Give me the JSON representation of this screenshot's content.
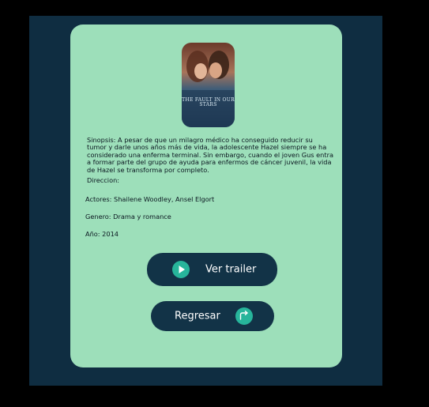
{
  "movie": {
    "poster_title": "THE FAULT IN OUR STARS",
    "synopsis": "Sinopsis: A pesar de que un milagro médico ha conseguido reducir su tumor y darle unos años más de vida, la adolescente Hazel siempre se ha considerado una enferma terminal. Sin embargo, cuando el joven Gus entra a formar parte del grupo de ayuda para enfermos de cáncer juvenil, la vida de Hazel se transforma por completo.",
    "direction": "Direccion:",
    "actors": "Actores: Shailene Woodley, Ansel Elgort",
    "genre": "Genero: Drama y romance",
    "year": "Año: 2014"
  },
  "buttons": {
    "trailer_label": "Ver trailer",
    "back_label": "Regresar"
  },
  "icons": {
    "play": "play-icon",
    "back": "return-arrow-icon"
  },
  "colors": {
    "page_background": "#000000",
    "frame_background": "#0f2d41",
    "card_background": "#9ddfba",
    "button_background": "#123347",
    "icon_accent": "#27b59b"
  }
}
